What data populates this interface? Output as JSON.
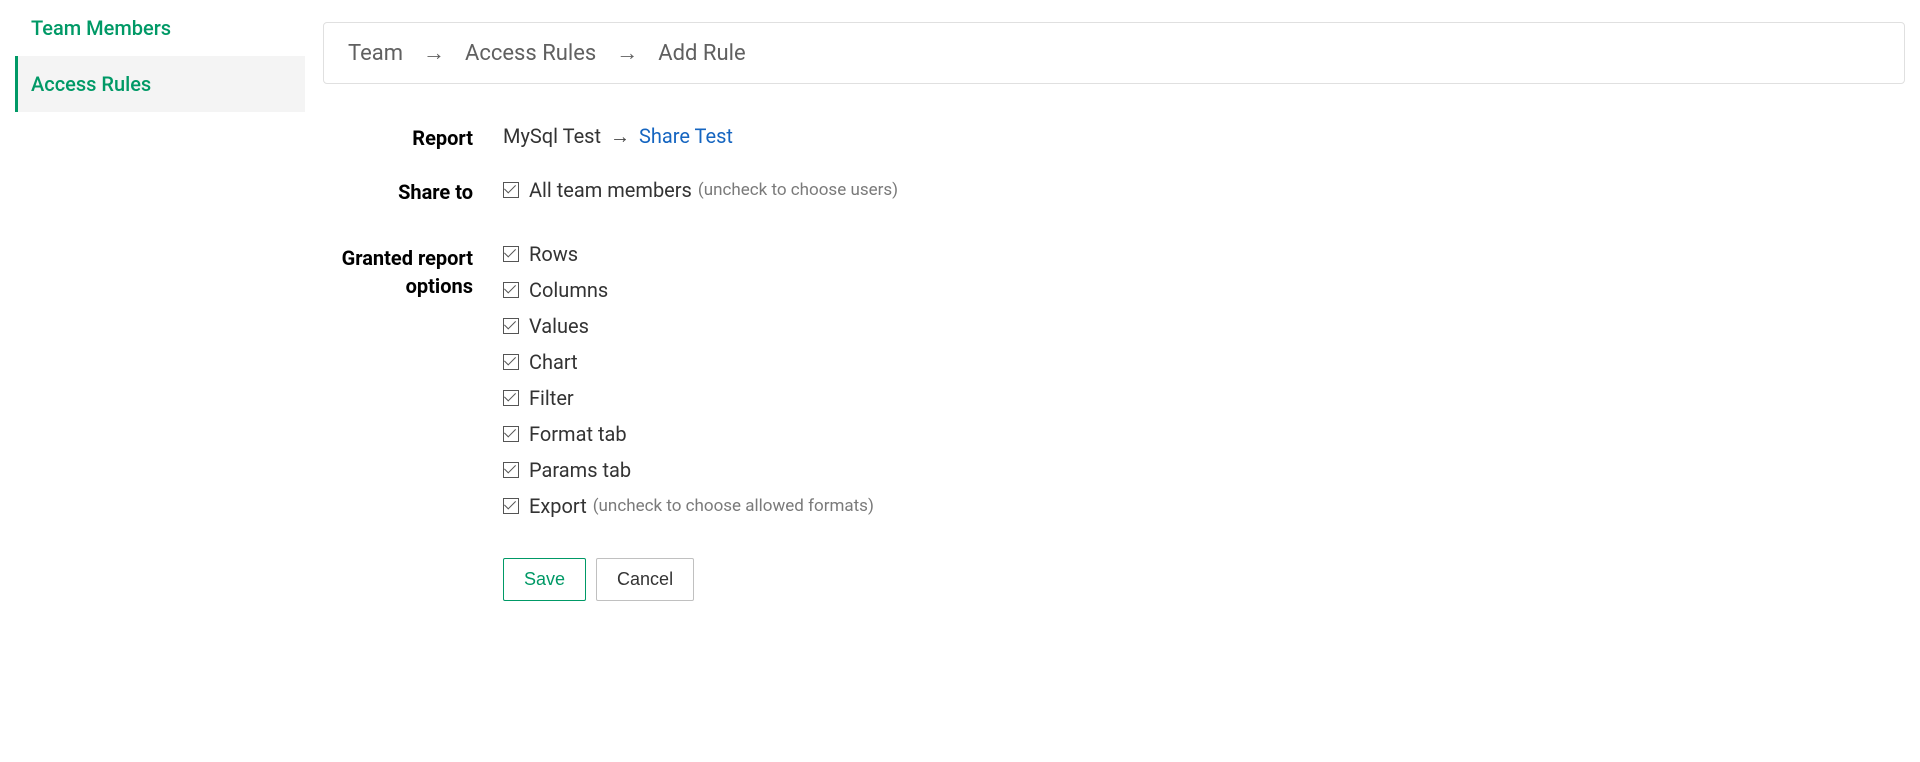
{
  "sidebar": {
    "items": [
      {
        "label": "Team Members"
      },
      {
        "label": "Access Rules"
      }
    ],
    "active_index": 1
  },
  "breadcrumb": {
    "parts": [
      "Team",
      "Access Rules",
      "Add Rule"
    ]
  },
  "form": {
    "report_label": "Report",
    "report_source": "MySql Test",
    "report_link": "Share Test",
    "share_label": "Share to",
    "share_all": {
      "label": "All team members",
      "hint": "(uncheck to choose users)",
      "checked": true
    },
    "grant_label": "Granted report options",
    "grant_options": [
      {
        "label": "Rows",
        "checked": true
      },
      {
        "label": "Columns",
        "checked": true
      },
      {
        "label": "Values",
        "checked": true
      },
      {
        "label": "Chart",
        "checked": true
      },
      {
        "label": "Filter",
        "checked": true
      },
      {
        "label": "Format tab",
        "checked": true
      },
      {
        "label": "Params tab",
        "checked": true
      },
      {
        "label": "Export",
        "hint": "(uncheck to choose allowed formats)",
        "checked": true
      }
    ],
    "save_label": "Save",
    "cancel_label": "Cancel"
  }
}
